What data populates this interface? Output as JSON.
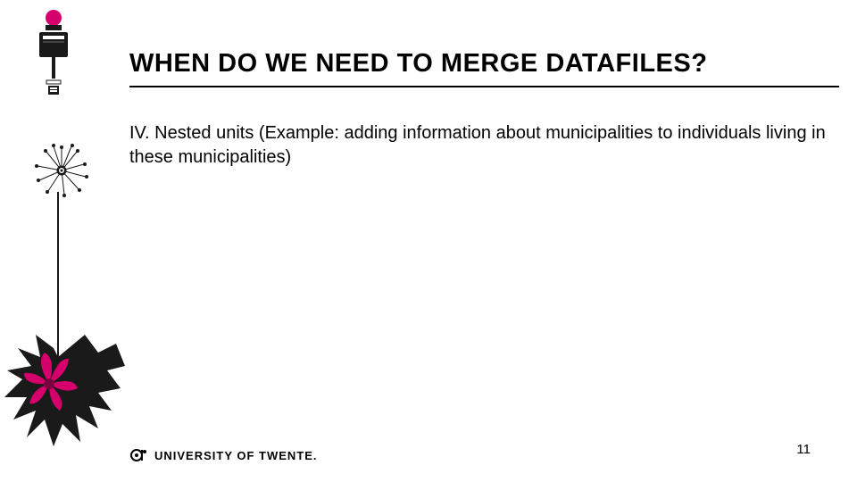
{
  "colors": {
    "accent": "#d6006c",
    "ink": "#1a1a1a"
  },
  "title": "WHEN DO WE NEED TO MERGE DATAFILES?",
  "body": "IV. Nested units (Example: adding information about municipalities to individuals living in these municipalities)",
  "footer": {
    "institution": "UNIVERSITY OF TWENTE."
  },
  "page_number": "11",
  "icons": {
    "top_left": "camera-mic-icon",
    "seed_head": "dandelion-seed-icon",
    "leaves": "leaves-flower-icon",
    "logo_mark": "ut-logo-mark"
  }
}
